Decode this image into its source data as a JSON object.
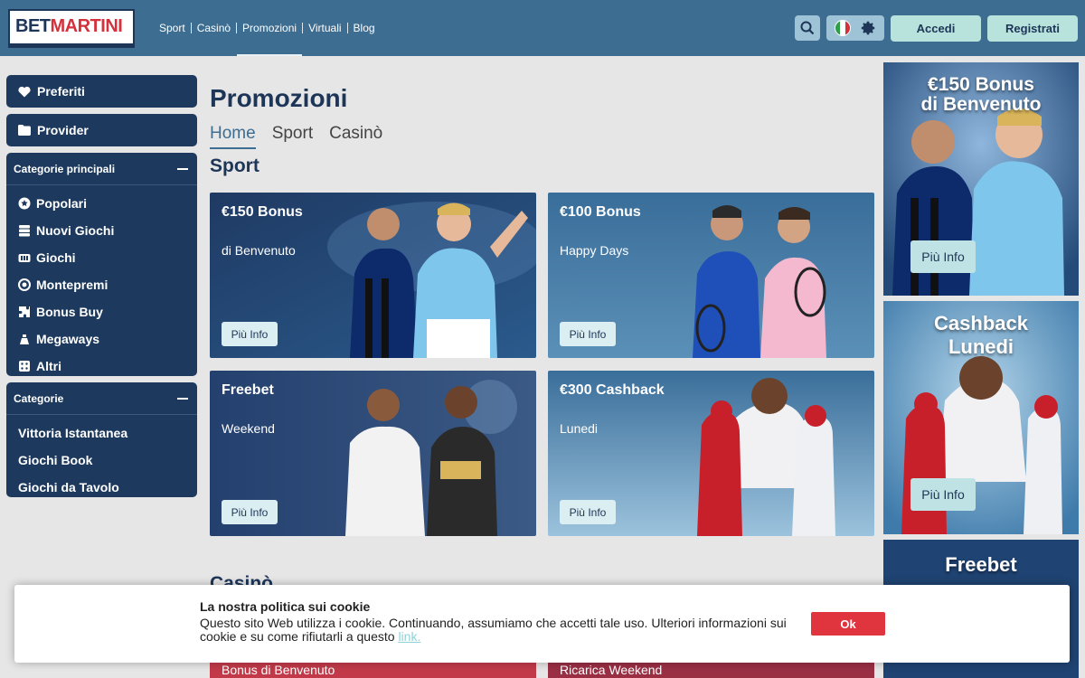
{
  "brand": {
    "logo_left": "BET",
    "logo_right": "MARTINI"
  },
  "nav": {
    "items": [
      "Sport",
      "Casinò",
      "Promozioni",
      "Virtuali",
      "Blog"
    ],
    "active": "Promozioni"
  },
  "header": {
    "login_label": "Accedi",
    "register_label": "Registrati",
    "icons": [
      "search-icon",
      "italy-flag-icon",
      "gear-icon"
    ]
  },
  "sidebar": {
    "favorites_label": "Preferiti",
    "provider_label": "Provider",
    "main_categories": {
      "title": "Categorie principali",
      "items": [
        {
          "label": "Popolari",
          "icon": "popular-icon"
        },
        {
          "label": "Nuovi Giochi",
          "icon": "new-games-icon"
        },
        {
          "label": "Giochi",
          "icon": "games-icon"
        },
        {
          "label": "Montepremi",
          "icon": "jackpot-icon"
        },
        {
          "label": "Bonus Buy",
          "icon": "puzzle-icon"
        },
        {
          "label": "Megaways",
          "icon": "megaways-icon"
        },
        {
          "label": "Altri",
          "icon": "dice-icon"
        }
      ]
    },
    "categories": {
      "title": "Categorie",
      "items": [
        "Vittoria Istantanea",
        "Giochi Book",
        "Giochi da Tavolo"
      ]
    }
  },
  "main": {
    "title": "Promozioni",
    "tabs": [
      "Home",
      "Sport",
      "Casinò"
    ],
    "active_tab": "Home",
    "sport_heading": "Sport",
    "casino_heading": "Casinò",
    "cards": [
      {
        "title": "€150 Bonus",
        "subtitle": "di Benvenuto",
        "button": "Più Info"
      },
      {
        "title": "€100 Bonus",
        "subtitle": "Happy Days",
        "button": "Più Info"
      },
      {
        "title": "Freebet",
        "subtitle": "Weekend",
        "button": "Più Info"
      },
      {
        "title": "€300 Cashback",
        "subtitle": "Lunedi",
        "button": "Più Info"
      }
    ],
    "casino_peek": [
      "Bonus di Benvenuto",
      "Ricarica Weekend"
    ]
  },
  "banners": [
    {
      "title_line1": "€150 Bonus",
      "title_line2": "di Benvenuto",
      "button": "Più Info"
    },
    {
      "title_line1": "Cashback",
      "title_line2": "Lunedi",
      "button": "Più Info"
    },
    {
      "title_line1": "Freebet",
      "title_line2": ""
    }
  ],
  "cookie": {
    "title": "La nostra politica sui cookie",
    "text": "Questo sito Web utilizza i cookie. Continuando, assumiamo che accetti tale uso. Ulteriori informazioni sui cookie e su come rifiutarli a questo",
    "link": "link.",
    "ok": "Ok"
  },
  "colors": {
    "header": "#3d6d91",
    "sidebar": "#1d3a5e",
    "accent_button": "#b8e2dc",
    "ok_button": "#e0353e"
  }
}
